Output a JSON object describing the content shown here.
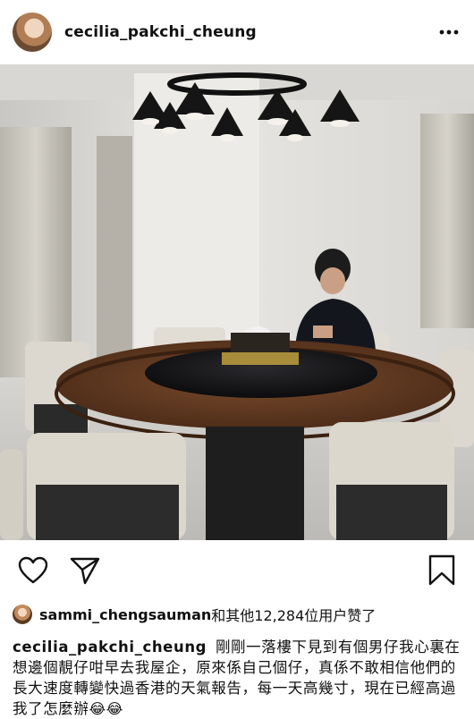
{
  "post": {
    "username": "cecilia_pakchi_cheung",
    "more_icon": "more-horizontal-icon"
  },
  "photo": {
    "description_icon": "post-photo"
  },
  "actions": {
    "like_icon": "heart-icon",
    "share_icon": "send-icon",
    "save_icon": "bookmark-icon"
  },
  "likes": {
    "user": "sammi_chengsauman",
    "text": "和其他12,284位用户赞了"
  },
  "caption": {
    "user": "cecilia_pakchi_cheung",
    "text": "剛剛一落樓下見到有個男仔我心裏在想邊個靚仔咁早去我屋企，原來係自己個仔，真係不敢相信他們的長大速度轉變快過香港的天氣報告，每一天高幾寸，現在已經高過我了怎麼辦",
    "emoji": "😂😂"
  }
}
